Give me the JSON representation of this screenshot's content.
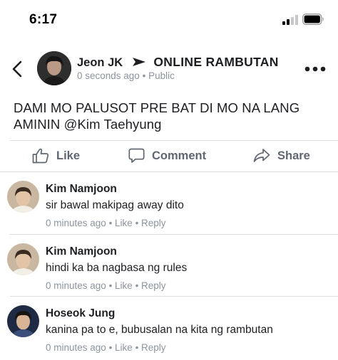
{
  "status_bar": {
    "time": "6:17",
    "signal_icon": "cellular-signal-icon",
    "battery_icon": "battery-icon"
  },
  "post": {
    "author": "Jeon JK",
    "group": "ONLINE RAMBUTAN",
    "timestamp": "0 seconds ago",
    "separator": " • ",
    "privacy": "Public",
    "text": "DAMI MO PALUSOT PRE BAT DI MO NA LANG AMININ @Kim Taehyung",
    "back_icon": "chevron-left-icon",
    "more_icon": "more-options-icon",
    "arrow_icon": "posted-to-arrow-icon"
  },
  "actions": {
    "like_label": "Like",
    "comment_label": "Comment",
    "share_label": "Share"
  },
  "comments": [
    {
      "name": "Kim Namjoon",
      "text": "sir bawal makipag away dito",
      "time": "0 minutes ago",
      "like_label": "Like",
      "reply_label": "Reply"
    },
    {
      "name": "Kim Namjoon",
      "text": "hindi ka ba nagbasa ng rules",
      "time": "0 minutes ago",
      "like_label": "Like",
      "reply_label": "Reply"
    },
    {
      "name": "Hoseok Jung",
      "text": "kanina pa to e, bubusalan na kita ng rambutan",
      "time": "0 minutes ago",
      "like_label": "Like",
      "reply_label": "Reply"
    }
  ],
  "meta_separator": " • ",
  "colors": {
    "text_primary": "#1c1e21",
    "text_secondary": "#8d949e",
    "action_gray": "#606770",
    "divider": "#dadde1"
  }
}
